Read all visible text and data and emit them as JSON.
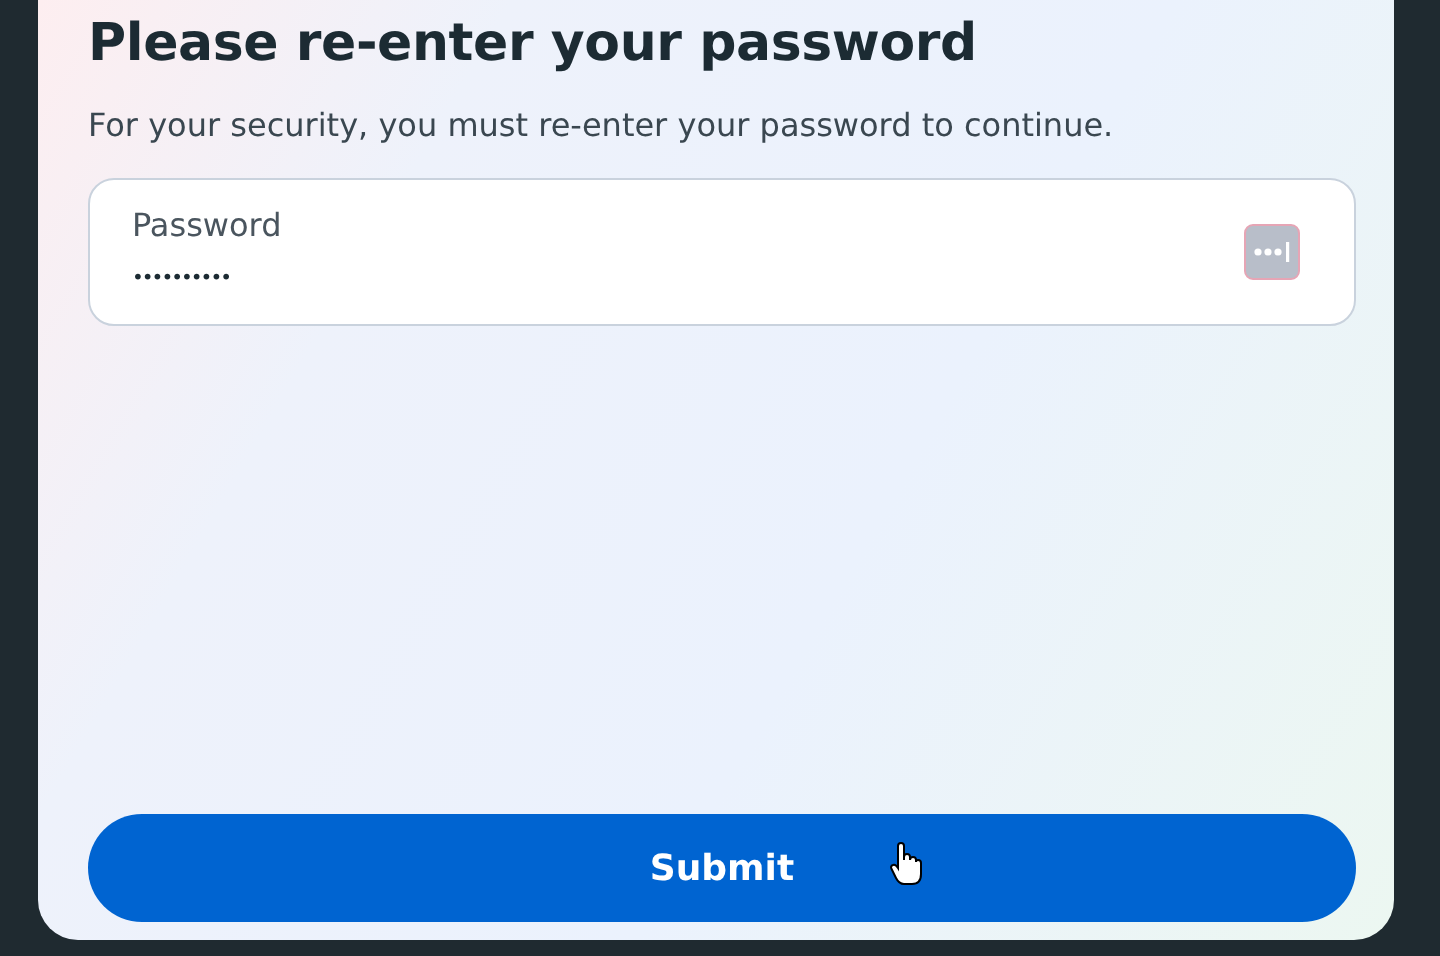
{
  "dialog": {
    "title": "Please re-enter your password",
    "description": "For your security, you must re-enter your password to continue."
  },
  "password_field": {
    "placeholder": "Password",
    "value": "••••••••••"
  },
  "submit_button": {
    "label": "Submit"
  }
}
